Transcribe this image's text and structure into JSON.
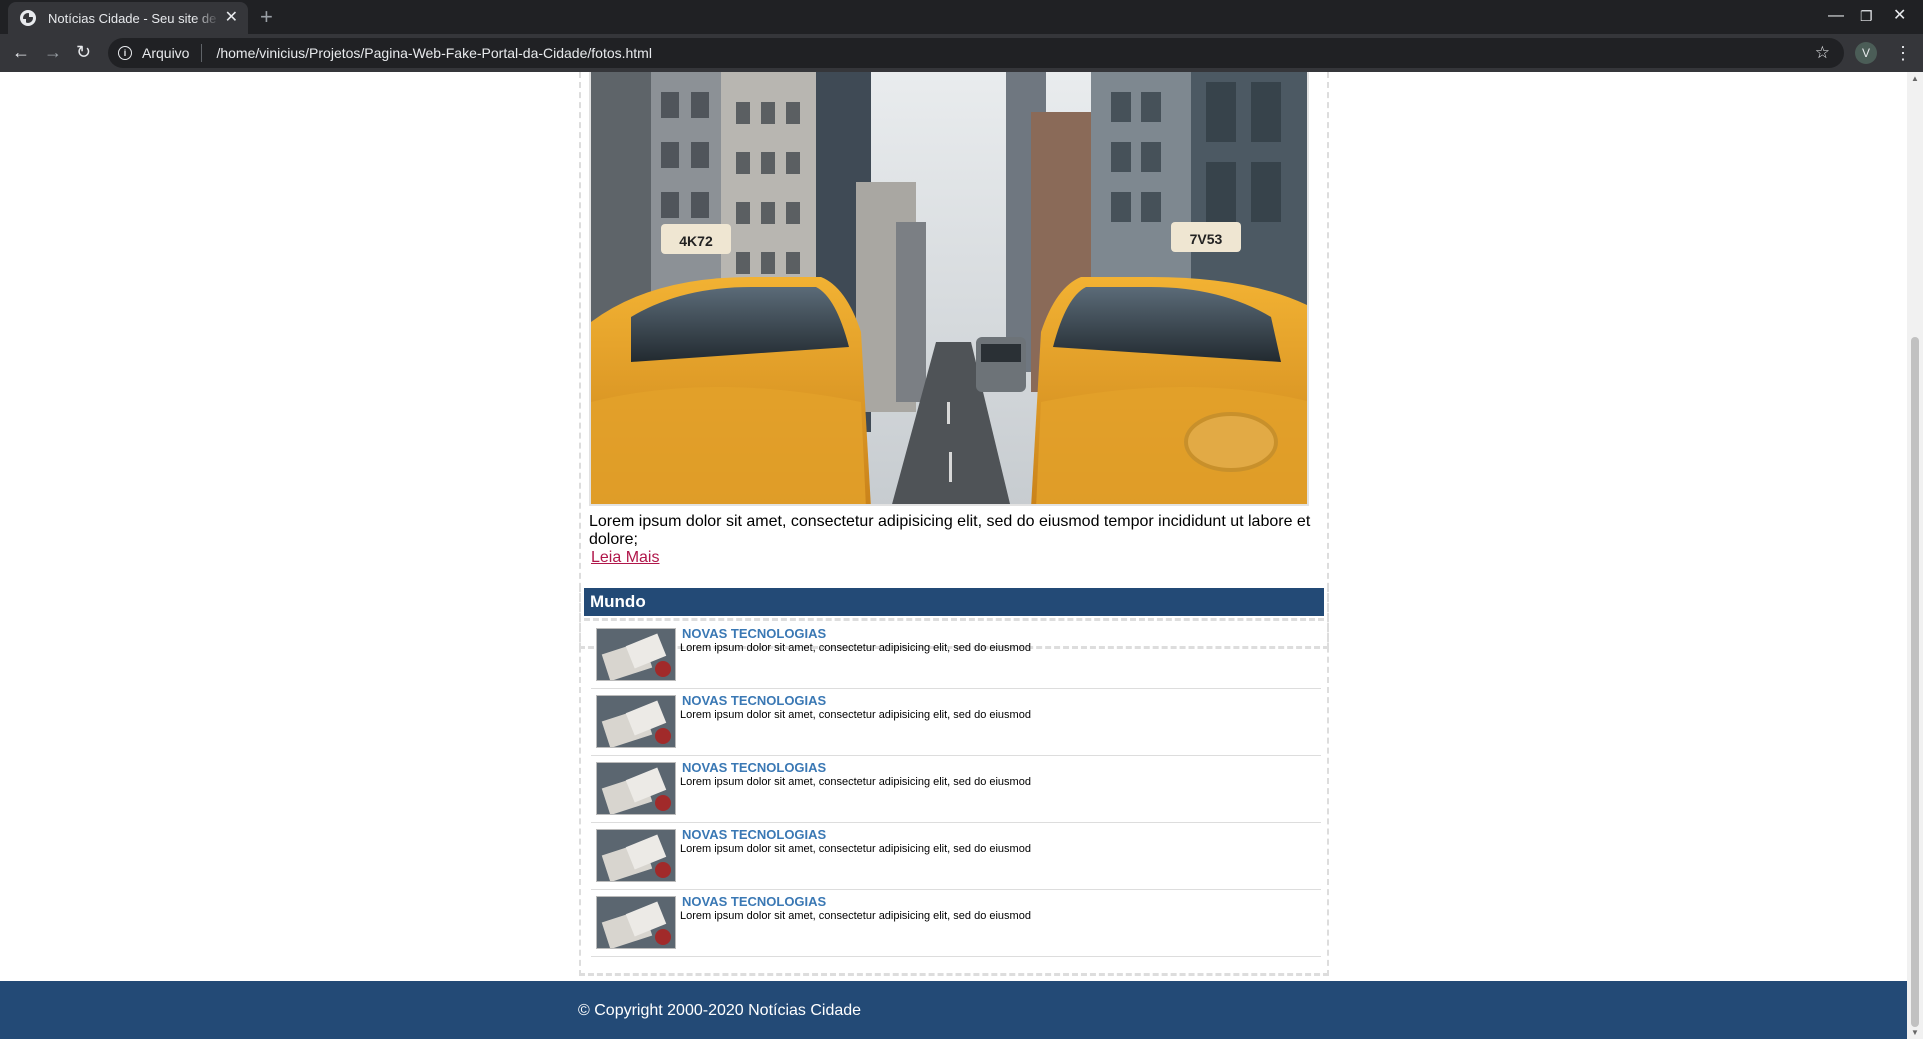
{
  "browser": {
    "tab_title": "Notícias Cidade - Seu site de notícias",
    "tab_close": "✕",
    "new_tab": "+",
    "security_label": "Arquivo",
    "url": "/home/vinicius/Projetos/Pagina-Web-Fake-Portal-da-Cidade/fotos.html",
    "profile_initial": "V",
    "icons": {
      "back": "arrow-left-icon",
      "forward": "arrow-right-icon",
      "reload": "reload-icon",
      "info": "info-icon",
      "bookmark": "star-icon",
      "menu": "kebab-menu-icon"
    }
  },
  "photo": {
    "caption": "Lorem ipsum dolor sit amet, consectetur adipisicing elit, sed do eiusmod tempor incididunt ut labore et dolore;",
    "read_more": "Leia Mais",
    "cab_left_plate": "4K72",
    "cab_right_plate": "7V53"
  },
  "mundo": {
    "heading": "Mundo",
    "items": [
      {
        "title": "NOVAS TECNOLOGIAS",
        "text": "Lorem ipsum dolor sit amet, consectetur adipisicing elit, sed do eiusmod"
      },
      {
        "title": "NOVAS TECNOLOGIAS",
        "text": "Lorem ipsum dolor sit amet, consectetur adipisicing elit, sed do eiusmod"
      },
      {
        "title": "NOVAS TECNOLOGIAS",
        "text": "Lorem ipsum dolor sit amet, consectetur adipisicing elit, sed do eiusmod"
      },
      {
        "title": "NOVAS TECNOLOGIAS",
        "text": "Lorem ipsum dolor sit amet, consectetur adipisicing elit, sed do eiusmod"
      },
      {
        "title": "NOVAS TECNOLOGIAS",
        "text": "Lorem ipsum dolor sit amet, consectetur adipisicing elit, sed do eiusmod"
      }
    ]
  },
  "footer": {
    "copyright": "© Copyright 2000-2020 Notícias Cidade"
  },
  "colors": {
    "header_blue": "#234a76",
    "link_blue": "#3a78b4",
    "read_more": "#b0164a",
    "taxi_yellow": "#e8a526"
  }
}
